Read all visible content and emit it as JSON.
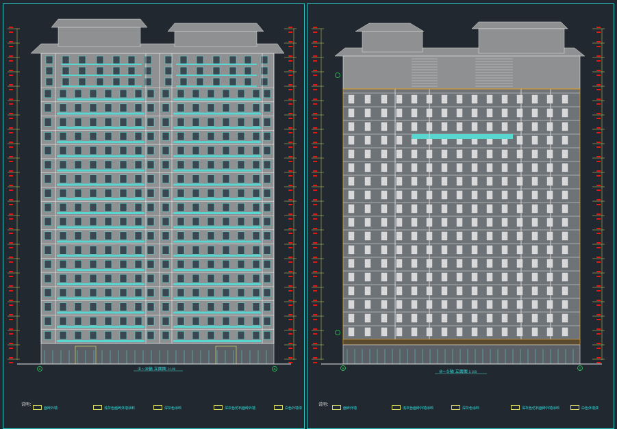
{
  "sheets": [
    {
      "id": "left",
      "title": "①~⑩轴 立面图",
      "scale": "1:100",
      "grid_start": "①",
      "grid_end": "⑩",
      "legend_heading": "说明：",
      "legend": [
        "面砖外墙",
        "浅灰色面砖外墙涂料",
        "深灰色涂料",
        "深灰色仿石面砖外墙",
        "白色外墙漆"
      ]
    },
    {
      "id": "right",
      "title": "⑩~①轴 立面图",
      "scale": "1:100",
      "grid_start": "⑩",
      "grid_end": "①",
      "legend_heading": "说明：",
      "legend": [
        "面砖外墙",
        "浅灰色面砖外墙涂料",
        "深灰色涂料",
        "深灰色仿石面砖外墙涂料",
        "白色外墙漆"
      ]
    }
  ],
  "colors": {
    "background": "#212830",
    "frame": "#2fc4c4",
    "facade": "#8e9091",
    "glass": "#58d6d2",
    "line": "#e8e8e8",
    "level_mark": "#e01818",
    "dimension": "#d8d860",
    "accent": "#e0a020"
  },
  "floors": 18
}
